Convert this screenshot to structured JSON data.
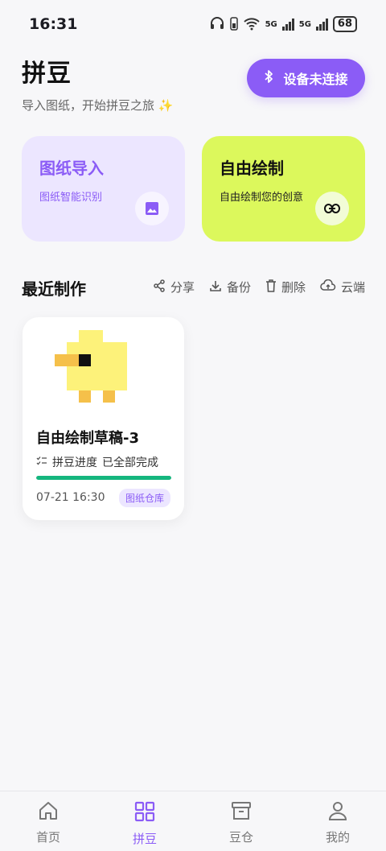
{
  "status_bar": {
    "time": "16:31",
    "battery": "68",
    "net1": "5G",
    "net2": "5G"
  },
  "header": {
    "title": "拼豆",
    "subtitle": "导入图纸，开始拼豆之旅 ✨",
    "ble_button_label": "设备未连接"
  },
  "cards": {
    "import": {
      "title": "图纸导入",
      "subtitle": "图纸智能识别",
      "icon": "image-icon"
    },
    "draw": {
      "title": "自由绘制",
      "subtitle": "自由绘制您的创意",
      "icon": "link-icon"
    }
  },
  "recent": {
    "title": "最近制作",
    "actions": [
      {
        "label": "分享",
        "icon": "share-icon"
      },
      {
        "label": "备份",
        "icon": "download-icon"
      },
      {
        "label": "删除",
        "icon": "trash-icon"
      },
      {
        "label": "云端",
        "icon": "cloud-upload-icon"
      }
    ],
    "works": [
      {
        "title": "自由绘制草稿-3",
        "progress_label": "拼豆进度",
        "progress_status": "已全部完成",
        "progress": 1.0,
        "time": "07-21 16:30",
        "tag": "图纸仓库"
      }
    ]
  },
  "bottom_nav": [
    {
      "label": "首页",
      "icon": "home-icon",
      "active": false
    },
    {
      "label": "拼豆",
      "icon": "grid-icon",
      "active": true
    },
    {
      "label": "豆仓",
      "icon": "archive-icon",
      "active": false
    },
    {
      "label": "我的",
      "icon": "user-icon",
      "active": false
    }
  ],
  "colors": {
    "accent": "#8b5cf6",
    "lime": "#dcf85c",
    "progress": "#15b67e"
  }
}
